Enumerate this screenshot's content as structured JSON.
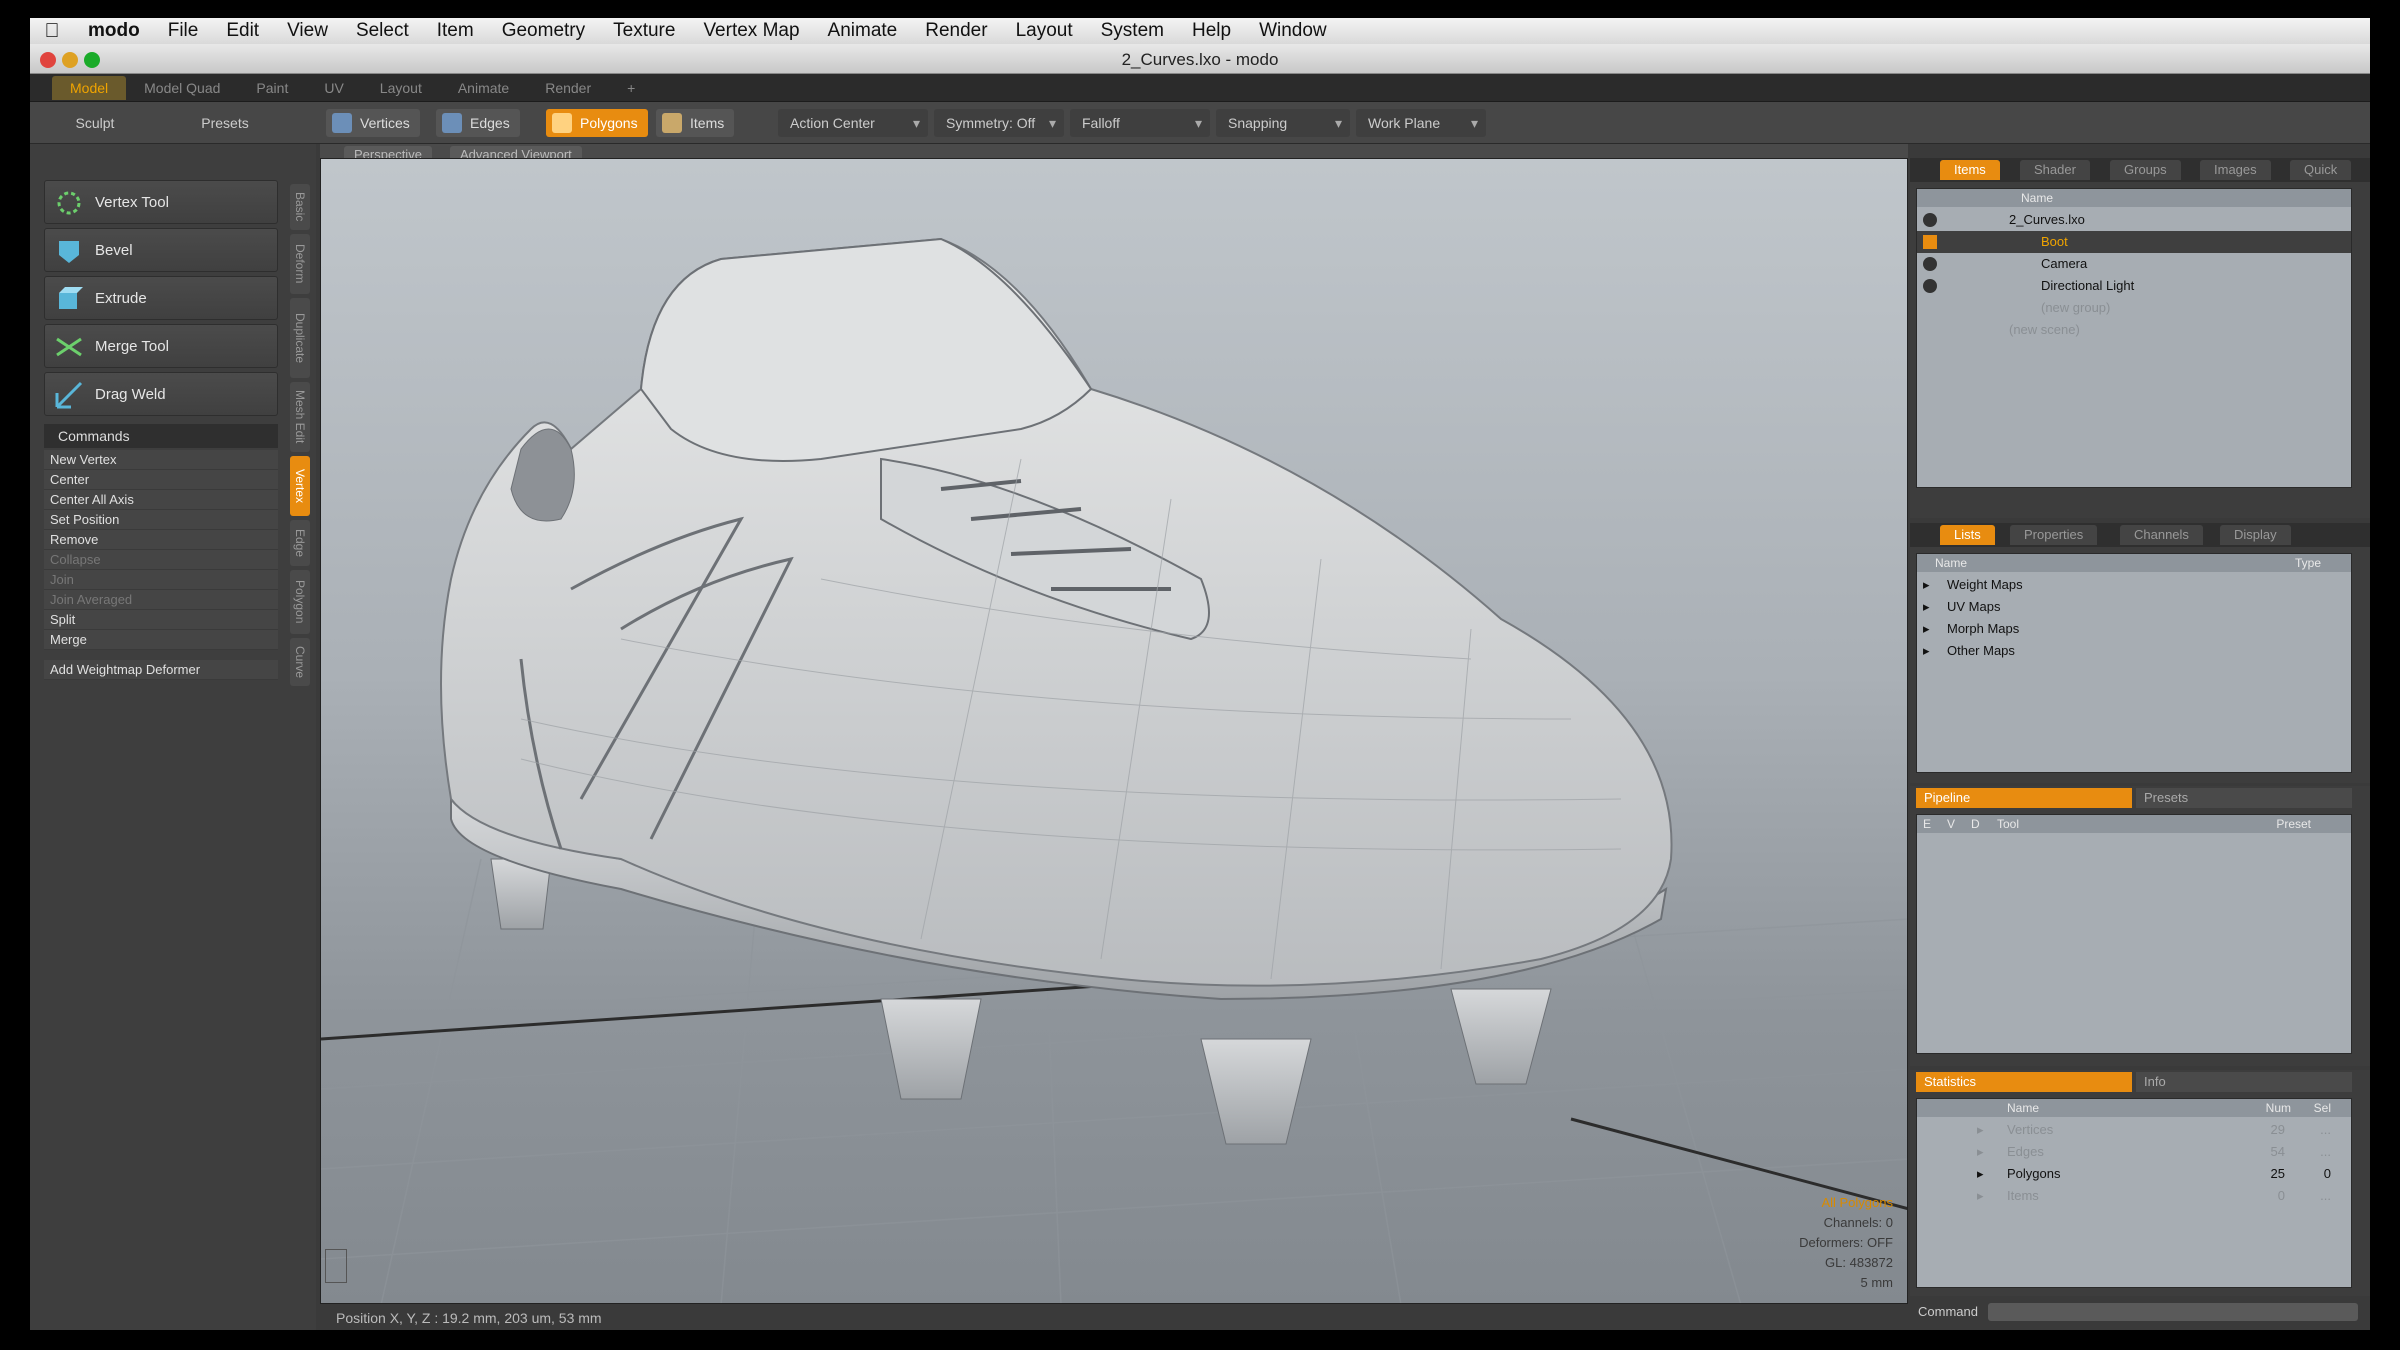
{
  "menubar": {
    "app_name": "modo",
    "items": [
      "File",
      "Edit",
      "View",
      "Select",
      "Item",
      "Geometry",
      "Texture",
      "Vertex Map",
      "Animate",
      "Render",
      "Layout",
      "System",
      "Help",
      "Window"
    ]
  },
  "window": {
    "title": "2_Curves.lxo - modo"
  },
  "layout_tabs": [
    "Model",
    "Model Quad",
    "Paint",
    "UV",
    "Layout",
    "Animate",
    "Render"
  ],
  "toolbar": {
    "left_tabs": [
      "Sculpt",
      "Presets"
    ],
    "selection_modes": [
      "Vertices",
      "Edges",
      "Polygons",
      "Items"
    ],
    "active_mode": "Polygons",
    "dropdowns": [
      "Action Center",
      "Symmetry: Off",
      "Falloff",
      "Snapping",
      "Work Plane"
    ]
  },
  "toolbox": {
    "tools": [
      "Vertex Tool",
      "Bevel",
      "Extrude",
      "Merge Tool",
      "Drag Weld"
    ],
    "commands_header": "Commands",
    "commands": [
      {
        "label": "New Vertex",
        "enabled": true
      },
      {
        "label": "Center",
        "enabled": true
      },
      {
        "label": "Center All Axis",
        "enabled": true
      },
      {
        "label": "Set Position",
        "enabled": true
      },
      {
        "label": "Remove",
        "enabled": true
      },
      {
        "label": "Collapse",
        "enabled": false
      },
      {
        "label": "Join",
        "enabled": false
      },
      {
        "label": "Join Averaged",
        "enabled": false
      },
      {
        "label": "Split",
        "enabled": true
      },
      {
        "label": "Merge",
        "enabled": true
      }
    ],
    "extra_command": "Add Weightmap Deformer",
    "vertical_tabs": [
      "Basic",
      "Deform",
      "Duplicate",
      "Mesh Edit",
      "Vertex",
      "Edge",
      "Polygon",
      "Curve"
    ],
    "active_vertical_tab": "Vertex"
  },
  "viewport": {
    "tabs": [
      "Perspective",
      "Advanced Viewport"
    ],
    "info": [
      "All Polygons",
      "Channels: 0",
      "Deformers: OFF",
      "GL: 483872",
      "5 mm"
    ],
    "status": "Position X, Y, Z :  19.2 mm, 203 um, 53 mm"
  },
  "items_panel": {
    "tabs": [
      "Items",
      "Shader",
      "Groups",
      "Images",
      "Quick"
    ],
    "header_name": "Name",
    "rows": [
      {
        "label": "2_Curves.lxo",
        "indent": 1
      },
      {
        "label": "Boot",
        "indent": 2,
        "selected": true
      },
      {
        "label": "Camera",
        "indent": 2
      },
      {
        "label": "Directional Light",
        "indent": 2
      },
      {
        "label": "(new group)",
        "indent": 2,
        "dim": true
      },
      {
        "label": "(new scene)",
        "indent": 1,
        "dim": true
      }
    ]
  },
  "lists_panel": {
    "tabs": [
      "Lists",
      "Properties",
      "Channels",
      "Display"
    ],
    "header_name": "Name",
    "header_type": "Type",
    "rows": [
      "Weight Maps",
      "UV Maps",
      "Morph Maps",
      "Other Maps"
    ]
  },
  "pipeline_panel": {
    "tabs": [
      "Pipeline",
      "Presets"
    ],
    "headers": [
      "E",
      "V",
      "D",
      "Tool",
      "Preset"
    ]
  },
  "stats_panel": {
    "tabs": [
      "Statistics",
      "Info"
    ],
    "headers": [
      "Name",
      "Num",
      "Sel"
    ],
    "rows": [
      {
        "label": "Vertices",
        "num": "29",
        "sel": "...",
        "dim": true
      },
      {
        "label": "Edges",
        "num": "54",
        "sel": "...",
        "dim": true
      },
      {
        "label": "Polygons",
        "num": "25",
        "sel": "0",
        "dim": false
      },
      {
        "label": "Items",
        "num": "0",
        "sel": "...",
        "dim": true
      }
    ]
  },
  "command_line": {
    "label": "Command"
  },
  "colors": {
    "accent": "#e88c10",
    "viewport_bg": "#aab0b6",
    "panel_bg": "#3d3d3d"
  }
}
